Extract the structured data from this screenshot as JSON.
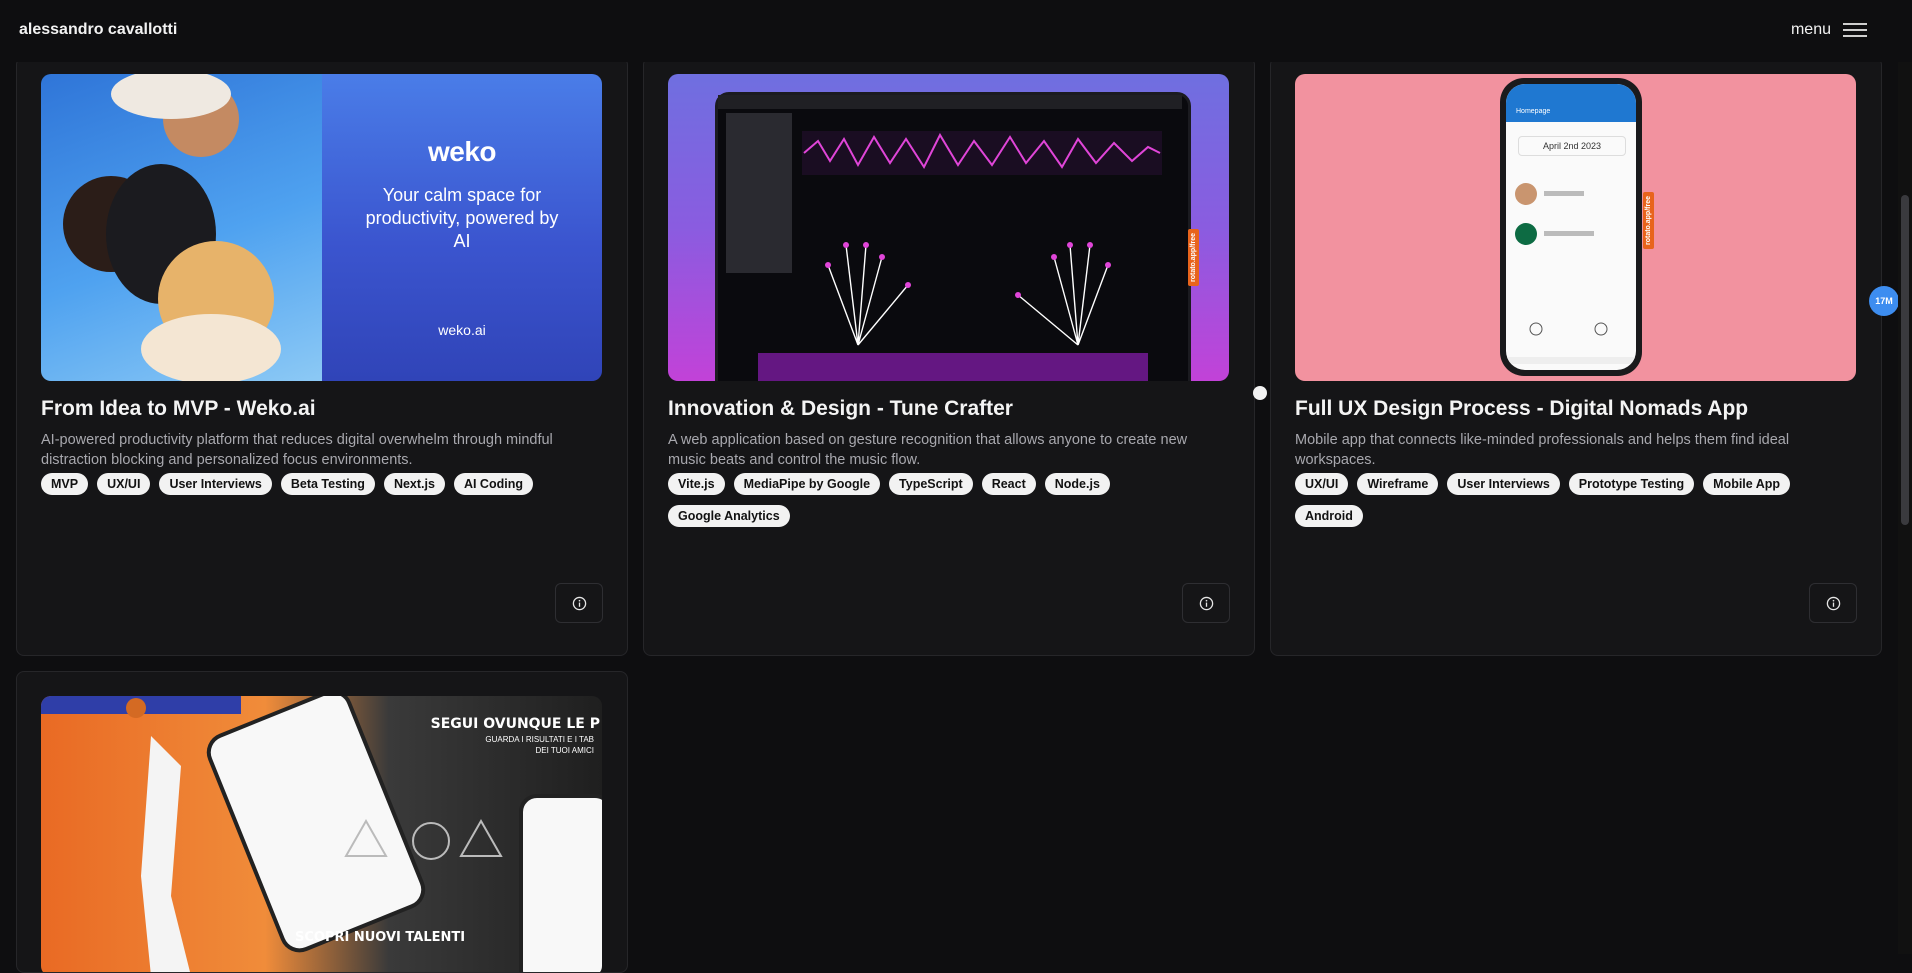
{
  "header": {
    "brand": "alessandro cavallotti",
    "menu_label": "menu"
  },
  "projects": [
    {
      "title": "From Idea to MVP - Weko.ai",
      "description": "AI-powered productivity platform that reduces digital overwhelm through mindful distraction blocking and personalized focus environments.",
      "tags": [
        "MVP",
        "UX/UI",
        "User Interviews",
        "Beta Testing",
        "Next.js",
        "AI Coding"
      ],
      "thumb": {
        "logo": "weko",
        "tagline": "Your calm space for productivity, powered by AI",
        "url": "weko.ai"
      }
    },
    {
      "title": "Innovation & Design - Tune Crafter",
      "description": "A web application based on gesture recognition that allows anyone to create new music beats and control the music flow.",
      "tags": [
        "Vite.js",
        "MediaPipe by Google",
        "TypeScript",
        "React",
        "Node.js",
        "Google Analytics"
      ],
      "thumb": {
        "watermark": "rotato.app/free"
      }
    },
    {
      "title": "Full UX Design Process - Digital Nomads App",
      "description": "Mobile app that connects like-minded professionals and helps them find ideal workspaces.",
      "tags": [
        "UX/UI",
        "Wireframe",
        "User Interviews",
        "Prototype Testing",
        "Mobile App",
        "Android"
      ],
      "thumb": {
        "screen_title": "Homepage",
        "date": "April 2nd 2023",
        "watermark": "rotato.app/free"
      }
    },
    {
      "thumb": {
        "headline": "SEGUI OVUNQUE LE P",
        "subline": "GUARDA I RISULTATI E I TAB DEI TUOI AMICI",
        "bottom": "SCOPRI NUOVI TALENTI"
      }
    }
  ],
  "badge": "17M",
  "colors": {
    "background": "#0e0e10",
    "card": "#151517",
    "tag_bg": "#f2f2f2",
    "badge": "#3d8df0"
  }
}
